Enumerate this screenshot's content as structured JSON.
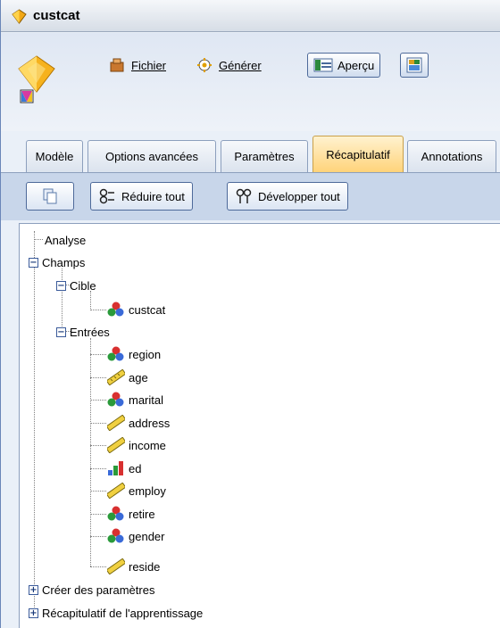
{
  "window": {
    "title": "custcat"
  },
  "toolbar": {
    "file": "Fichier",
    "generate": "Générer",
    "preview": "Aperçu"
  },
  "tabs": [
    "Modèle",
    "Options avancées",
    "Paramètres",
    "Récapitulatif",
    "Annotations"
  ],
  "summary": {
    "collapse_all": "Réduire tout",
    "expand_all": "Développer tout"
  },
  "tree": {
    "analysis": "Analyse",
    "fields": "Champs",
    "target": "Cible",
    "target_field": "custcat",
    "inputs": "Entrées",
    "input_fields": [
      "region",
      "age",
      "marital",
      "address",
      "income",
      "ed",
      "employ",
      "retire",
      "gender",
      "reside"
    ],
    "build_settings": "Créer des paramètres",
    "training_summary": "Récapitulatif de l'apprentissage"
  },
  "colors": {
    "active_tab": "#ffd37a",
    "tree_line": "#808080"
  }
}
